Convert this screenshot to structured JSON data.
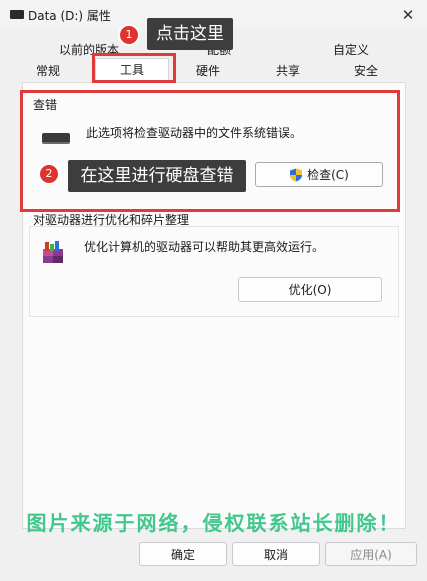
{
  "window": {
    "title": "Data (D:) 属性",
    "close_glyph": "✕"
  },
  "tabs_row1": [
    "以前的版本",
    "配额",
    "自定义"
  ],
  "tabs_row2": [
    "常规",
    "工具",
    "硬件",
    "共享",
    "安全"
  ],
  "error_check": {
    "title": "查错",
    "description": "此选项将检查驱动器中的文件系统错误。",
    "button": "检查(C)"
  },
  "optimize": {
    "title": "对驱动器进行优化和碎片整理",
    "description": "优化计算机的驱动器可以帮助其更高效运行。",
    "button": "优化(O)"
  },
  "footer": {
    "ok": "确定",
    "cancel": "取消",
    "apply": "应用(A)"
  },
  "annotations": {
    "step1_number": "1",
    "step1_text": "点击这里",
    "step2_number": "2",
    "step2_text": "在这里进行硬盘查错"
  },
  "watermark": "图片来源于网络，侵权联系站长删除！",
  "colors": {
    "highlight_red": "#e13a3a",
    "badge_red": "#e0322f",
    "tooltip_bg": "#3d3d3d",
    "watermark_green": "#22c07a"
  }
}
